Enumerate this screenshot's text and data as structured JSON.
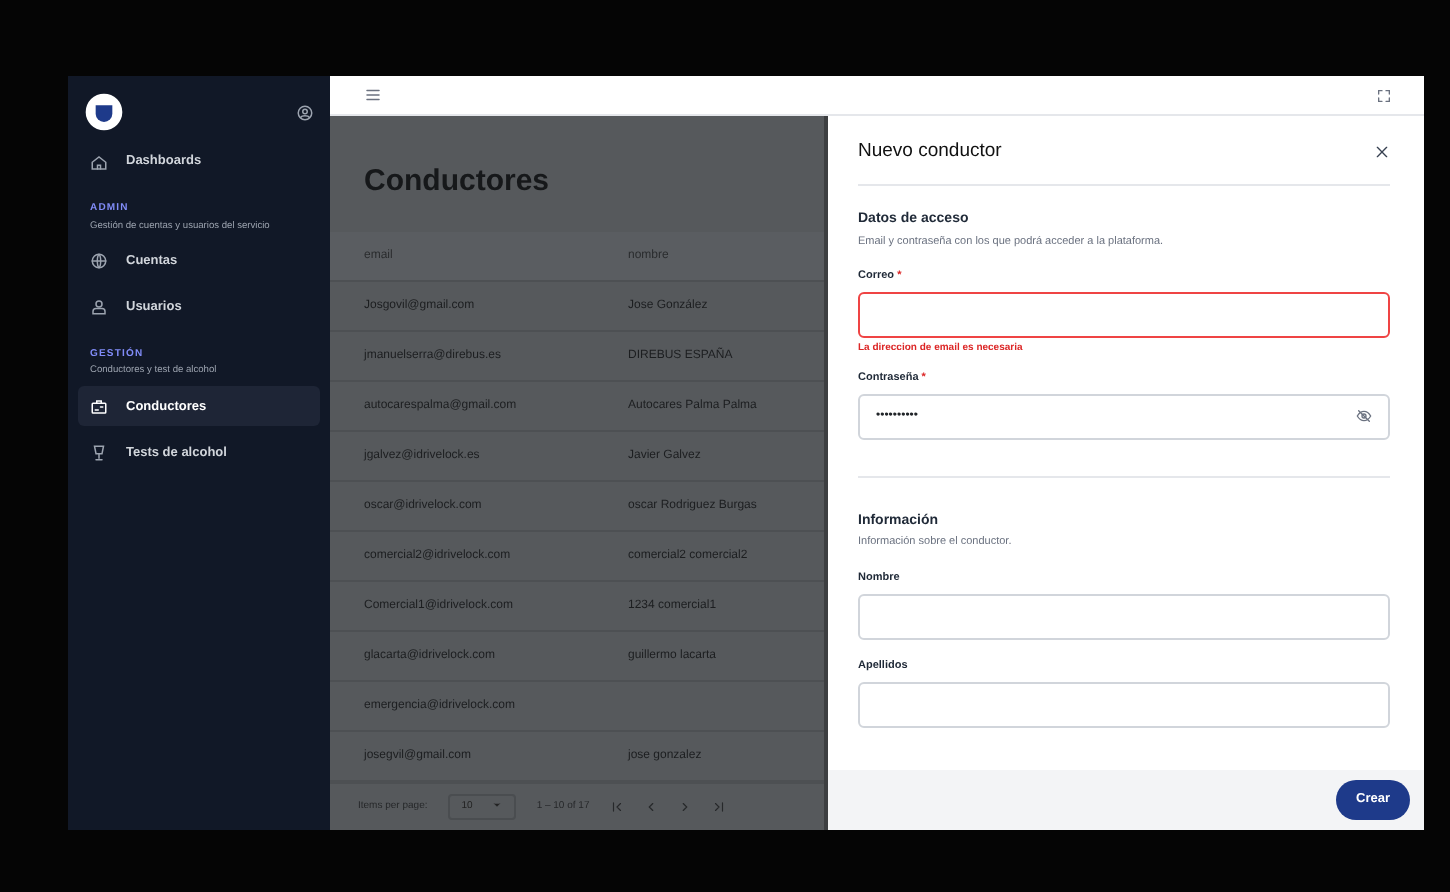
{
  "sidebar": {
    "items": [
      {
        "kind": "link",
        "label": "Dashboards",
        "selected": false
      },
      {
        "kind": "section",
        "label": "ADMIN",
        "subtitle": "Gestión de cuentas y usuarios del servicio"
      },
      {
        "kind": "link",
        "label": "Cuentas",
        "selected": false
      },
      {
        "kind": "link",
        "label": "Usuarios",
        "selected": false
      },
      {
        "kind": "section",
        "label": "GESTIÓN",
        "subtitle": "Conductores y test de alcohol"
      },
      {
        "kind": "link",
        "label": "Conductores",
        "selected": true
      },
      {
        "kind": "link",
        "label": "Tests de alcohol",
        "selected": false
      }
    ]
  },
  "page": {
    "title": "Conductores",
    "table": {
      "columns": [
        "email",
        "nombre"
      ],
      "rows": [
        [
          "Josgovil@gmail.com",
          "Jose González"
        ],
        [
          "jmanuelserra@direbus.es",
          "DIREBUS ESPAÑA"
        ],
        [
          "autocarespalma@gmail.com",
          "Autocares Palma Palma"
        ],
        [
          "jgalvez@idrivelock.es",
          "Javier Galvez"
        ],
        [
          "oscar@idrivelock.com",
          "oscar Rodriguez Burgas"
        ],
        [
          "comercial2@idrivelock.com",
          "comercial2 comercial2"
        ],
        [
          "Comercial1@idrivelock.com",
          "1234 comercial1"
        ],
        [
          "glacarta@idrivelock.com",
          "guillermo lacarta"
        ],
        [
          "emergencia@idrivelock.com",
          null
        ],
        [
          "josegvil@gmail.com",
          "jose gonzalez"
        ]
      ]
    },
    "paginator": {
      "label": "Items per page:",
      "page_size": "10",
      "range": "1 – 10 of 17"
    }
  },
  "drawer": {
    "title": "Nuevo conductor",
    "sections": [
      {
        "title": "Datos de acceso",
        "description": "Email y contraseña con los que podrá acceder a la plataforma.",
        "fields": [
          {
            "kind": "text",
            "label": "Correo",
            "required_mark": "*",
            "invalid": true,
            "error": "La direccion de email es necesaria"
          },
          {
            "kind": "password",
            "label": "Contraseña",
            "required_mark": "*",
            "value": "••••••••••",
            "invalid": false
          }
        ]
      },
      {
        "title": "Información",
        "description": "Información sobre el conductor.",
        "fields": [
          {
            "kind": "text",
            "label": "Nombre",
            "invalid": false
          },
          {
            "kind": "text",
            "label": "Apellidos",
            "invalid": false
          }
        ]
      }
    ],
    "submit": "Crear"
  }
}
